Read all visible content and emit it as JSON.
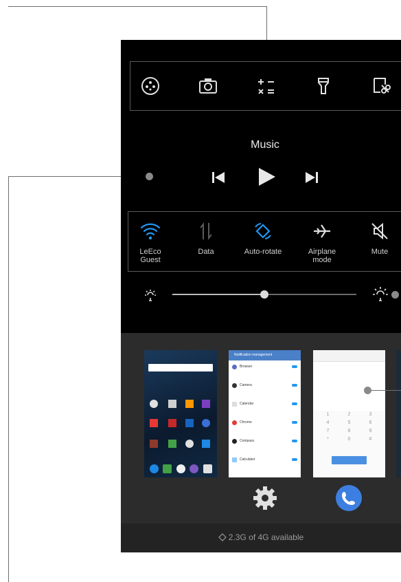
{
  "toolbar": {
    "items": [
      {
        "name": "assistive-touch",
        "icon": "dots-circle-icon"
      },
      {
        "name": "camera",
        "icon": "camera-icon"
      },
      {
        "name": "calculator",
        "icon": "calculator-icon"
      },
      {
        "name": "flashlight",
        "icon": "flashlight-icon"
      },
      {
        "name": "screenshot",
        "icon": "screenshot-scissors-icon"
      }
    ]
  },
  "music": {
    "title": "Music"
  },
  "quick_settings": {
    "wifi": {
      "line1": "LeEco",
      "line2": "Guest",
      "active": true
    },
    "data": {
      "line1": "Data",
      "line2": "",
      "active": false
    },
    "rotate": {
      "line1": "Auto-rotate",
      "line2": "",
      "active": true
    },
    "airplane": {
      "line1": "Airplane",
      "line2": "mode",
      "active": false
    },
    "mute": {
      "line1": "Mute",
      "line2": "",
      "active": false
    }
  },
  "brightness": {
    "level": 0.5
  },
  "recents": {
    "cards": [
      "home-screen",
      "notification-management",
      "phone-dialer"
    ],
    "notif_title": "Notification management",
    "notif_apps": [
      "Browser",
      "Camera",
      "Calendar",
      "Chrome",
      "Compass",
      "Calculator"
    ],
    "dialer_keys": [
      "1",
      "2",
      "3",
      "4",
      "5",
      "6",
      "7",
      "8",
      "9",
      "*",
      "0",
      "#"
    ]
  },
  "storage": {
    "text": "2.3G of 4G available"
  },
  "colors": {
    "accent": "#2196f3",
    "background": "#000000",
    "recents_bg": "#2c2c2c"
  }
}
